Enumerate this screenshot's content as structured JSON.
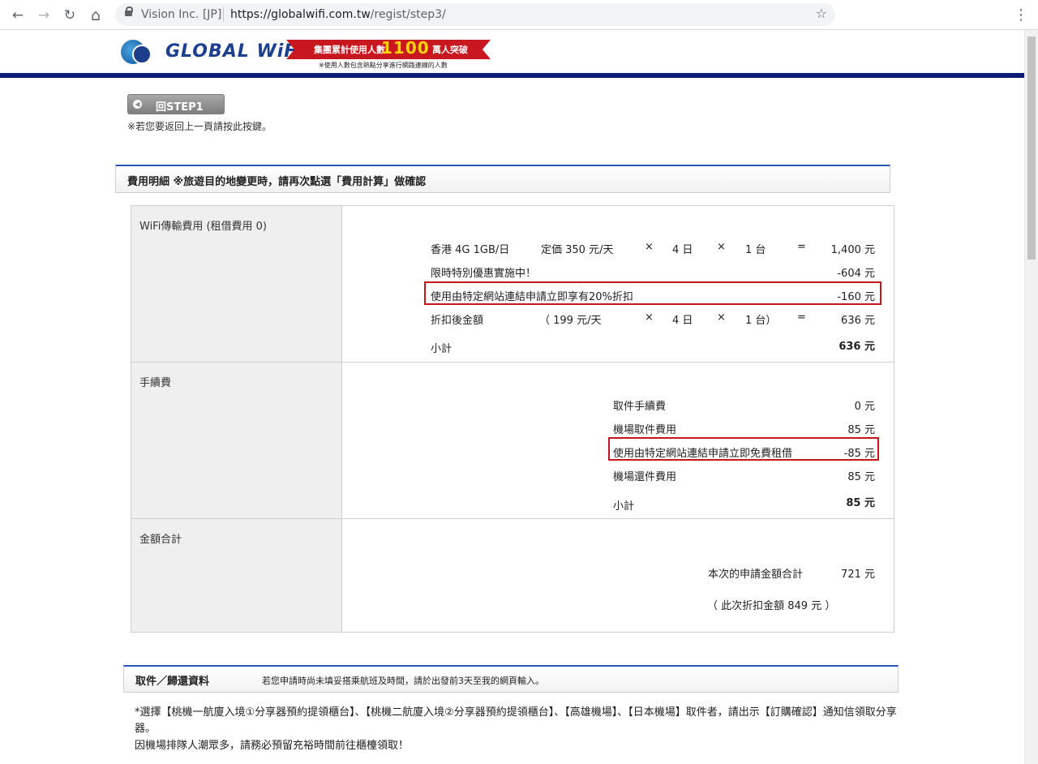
{
  "browser": {
    "site_name": "Vision Inc. [JP]",
    "url_prefix": "https://globalwifi.com.tw",
    "url_path": "/regist/step3/",
    "back_icon": "←",
    "forward_icon": "→",
    "reload_icon": "↻",
    "home_icon": "⌂",
    "star_icon": "☆",
    "menu_icon": "⋮"
  },
  "header": {
    "logo_text": "GLOBAL WiFi",
    "banner_text_left": "集團累計使用人數",
    "banner_number": "1100",
    "banner_text_right": "萬人突破",
    "banner_note": "※使用人數包含熱點分享進行網路連線的人數"
  },
  "back": {
    "button_label": "回STEP1",
    "note": "※若您要返回上一頁請按此按鍵。"
  },
  "fee_section": {
    "title": "費用明細 ※旅遊目的地變更時，請再次點選「費用計算」做確認"
  },
  "wifi": {
    "label": "WiFi傳輸費用 (租借費用 0)",
    "plan": "香港 4G 1GB/日",
    "list_price": "定価 350 元/天",
    "times": "×",
    "days": "4 日",
    "units": "1 台",
    "equals": "=",
    "amount": "1,400 元",
    "promo_label": "限時特別優惠實施中！",
    "promo_amount": "-604 元",
    "link_discount_label": "使用由特定網站連結申請立即享有20%折扣",
    "link_discount_amount": "-160 元",
    "after_label": "折扣後金額",
    "after_open": "（ 199 元/天",
    "after_units": "1 台）",
    "after_amount": "636 元",
    "subtotal_label": "小計",
    "subtotal_amount": "636 元"
  },
  "handling": {
    "label": "手續費",
    "pickup_fee_label": "取件手續費",
    "pickup_fee_amount": "0 元",
    "airport_pickup_label": "機場取件費用",
    "airport_pickup_amount": "85 元",
    "free_rent_label": "使用由特定網站連結申請立即免費租借",
    "free_rent_amount": "-85 元",
    "airport_return_label": "機場還件費用",
    "airport_return_amount": "85 元",
    "subtotal_label": "小計",
    "subtotal_amount": "85 元"
  },
  "total": {
    "label": "金額合計",
    "total_label": "本次的申請金額合計",
    "total_amount": "721 元",
    "discount_note": "（ 此次折扣金額 849 元 ）"
  },
  "pickup_section": {
    "title": "取件／歸還資料",
    "subtitle": "若您申請時尚未填妥搭乘航班及時間，請於出發前3天至我的網頁輸入。",
    "para1": "*選擇【桃機一航廈入境①分享器預約提領櫃台】、【桃機二航廈入境②分享器預約提領櫃台】、【高雄機場】、【日本機場】取件者，請出示【訂購確認】通知信領取分享器。",
    "para2": "因機場排隊人潮眾多，請務必預留充裕時間前往櫃檯領取！"
  }
}
